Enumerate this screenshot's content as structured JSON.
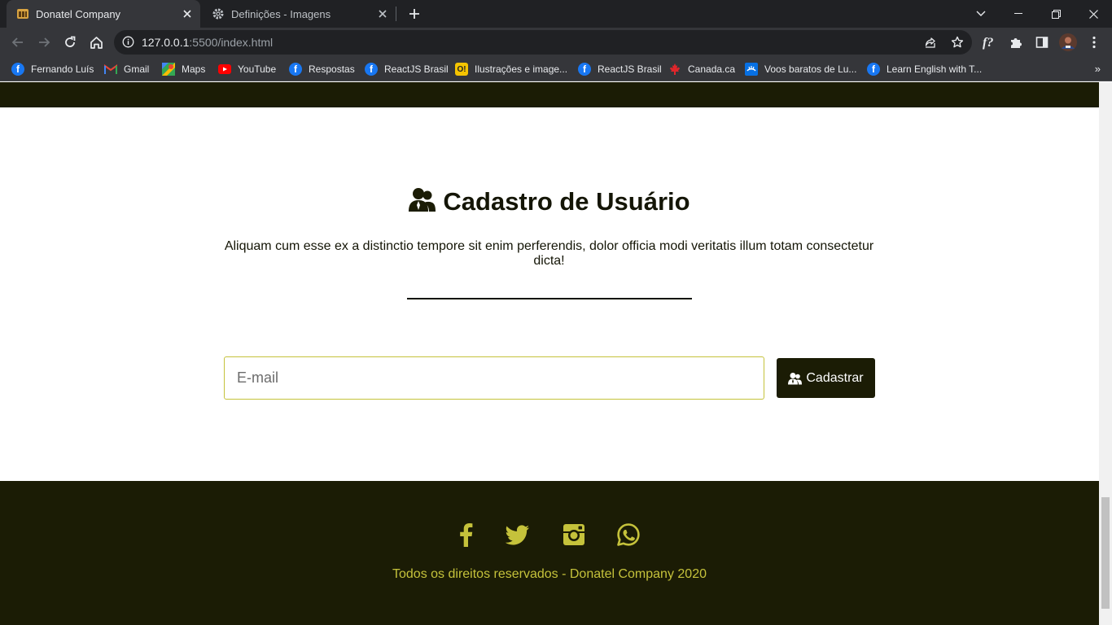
{
  "browser": {
    "tabs": [
      {
        "title": "Donatel Company",
        "icon": "site-favicon",
        "active": true
      },
      {
        "title": "Definições - Imagens",
        "icon": "gear-icon",
        "active": false
      }
    ],
    "url_host": "127.0.0.1",
    "url_rest": ":5500/index.html",
    "bookmarks": [
      {
        "label": "Fernando Luís",
        "icon": "facebook-icon"
      },
      {
        "label": "Gmail",
        "icon": "gmail-icon"
      },
      {
        "label": "Maps",
        "icon": "maps-icon"
      },
      {
        "label": "YouTube",
        "icon": "youtube-icon"
      },
      {
        "label": "Respostas",
        "icon": "facebook-icon"
      },
      {
        "label": "ReactJS Brasil",
        "icon": "facebook-icon"
      },
      {
        "label": "Ilustrações e image...",
        "icon": "o-icon"
      },
      {
        "label": "ReactJS Brasil",
        "icon": "facebook-icon"
      },
      {
        "label": "Canada.ca",
        "icon": "maple-leaf-icon"
      },
      {
        "label": "Voos baratos de Lu...",
        "icon": "flights-icon"
      },
      {
        "label": "Learn English with T...",
        "icon": "facebook-icon"
      }
    ],
    "more_bookmarks": "»"
  },
  "page": {
    "title": "Cadastro de Usuário",
    "description": "Aliquam cum esse ex a distinctio tempore sit enim perferendis, dolor officia modi veritatis illum totam consectetur dicta!",
    "email_placeholder": "E-mail",
    "submit_label": "Cadastrar"
  },
  "footer": {
    "social": [
      "facebook-icon",
      "twitter-icon",
      "instagram-icon",
      "whatsapp-icon"
    ],
    "copyright": "Todos os direitos reservados - Donatel Company 2020"
  },
  "colors": {
    "dark": "#1b1c05",
    "accent": "#c5c23b",
    "chrome_dark": "#202124",
    "chrome": "#35363a"
  }
}
